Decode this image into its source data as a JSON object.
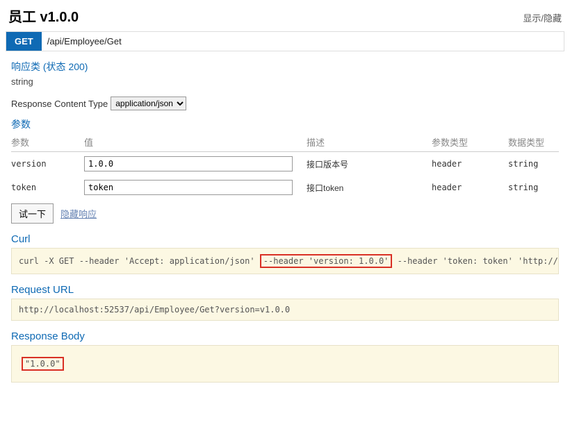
{
  "header": {
    "title": "员工 v1.0.0",
    "toggle": "显示/隐藏"
  },
  "op": {
    "method": "GET",
    "path": "/api/Employee/Get"
  },
  "response_class": {
    "label": "响应类 (状态 200)",
    "type": "string"
  },
  "content_type": {
    "label": "Response Content Type",
    "selected": "application/json"
  },
  "params_label": "参数",
  "params_headers": {
    "name": "参数",
    "value": "值",
    "desc": "描述",
    "paramType": "参数类型",
    "dataType": "数据类型"
  },
  "params": [
    {
      "name": "version",
      "value": "1.0.0",
      "desc": "接口版本号",
      "paramType": "header",
      "dataType": "string"
    },
    {
      "name": "token",
      "value": "token",
      "desc": "接口token",
      "paramType": "header",
      "dataType": "string"
    }
  ],
  "try_button": "试一下",
  "hide_response": "隐藏响应",
  "curl": {
    "label": "Curl",
    "pre": "curl -X GET --header 'Accept: application/json' ",
    "hl": "--header 'version: 1.0.0'",
    "post": " --header 'token: token' 'http://local"
  },
  "request_url": {
    "label": "Request URL",
    "value": "http://localhost:52537/api/Employee/Get?version=v1.0.0"
  },
  "response_body": {
    "label": "Response Body",
    "value": "\"1.0.0\""
  }
}
